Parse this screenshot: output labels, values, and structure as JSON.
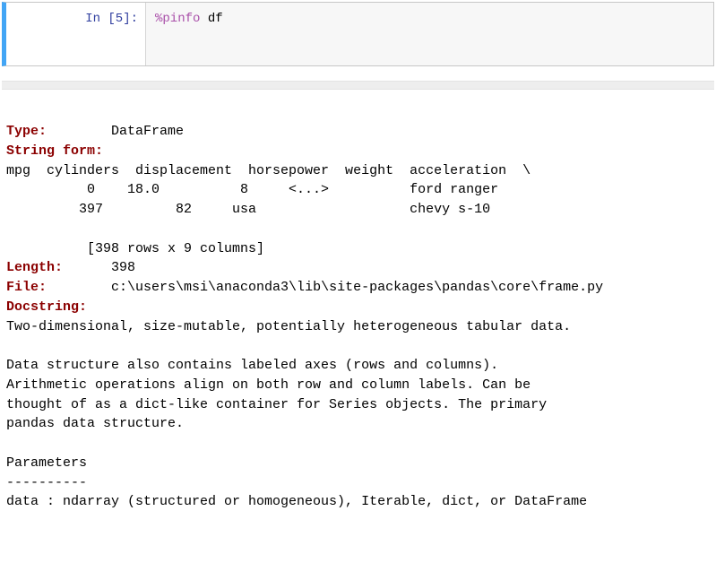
{
  "cell": {
    "prompt": "In [5]:",
    "code_magic": "%pinfo",
    "code_arg": " df"
  },
  "output": {
    "type_label": "Type:",
    "type_value": "        DataFrame",
    "string_form_label": "String form:",
    "string_form_lines": [
      "mpg  cylinders  displacement  horsepower  weight  acceleration  \\",
      "          0    18.0          8     <...>          ford ranger",
      "         397         82     usa                   chevy s-10",
      "",
      "          [398 rows x 9 columns]"
    ],
    "length_label": "Length:",
    "length_value": "      398",
    "file_label": "File:",
    "file_value": "        c:\\users\\msi\\anaconda3\\lib\\site-packages\\pandas\\core\\frame.py",
    "docstring_label": "Docstring:",
    "docstring_lines": [
      "Two-dimensional, size-mutable, potentially heterogeneous tabular data.",
      "",
      "Data structure also contains labeled axes (rows and columns).",
      "Arithmetic operations align on both row and column labels. Can be",
      "thought of as a dict-like container for Series objects. The primary",
      "pandas data structure.",
      "",
      "Parameters",
      "----------",
      "data : ndarray (structured or homogeneous), Iterable, dict, or DataFrame"
    ]
  }
}
